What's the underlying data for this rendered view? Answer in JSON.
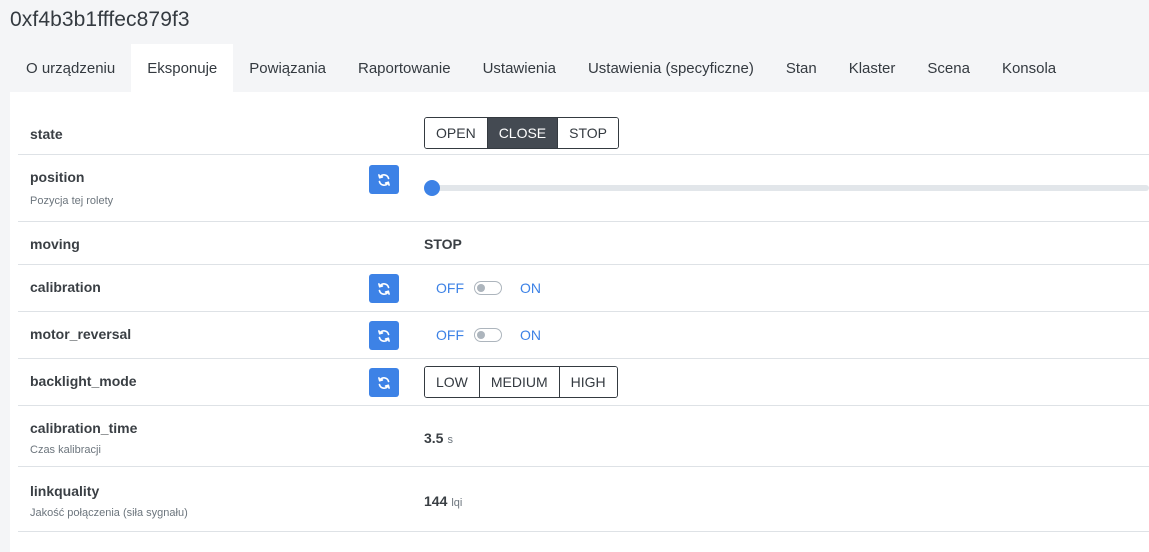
{
  "device": {
    "title": "0xf4b3b1fffec879f3"
  },
  "tabs": [
    {
      "label": "O urządzeniu",
      "active": false
    },
    {
      "label": "Eksponuje",
      "active": true
    },
    {
      "label": "Powiązania",
      "active": false
    },
    {
      "label": "Raportowanie",
      "active": false
    },
    {
      "label": "Ustawienia",
      "active": false
    },
    {
      "label": "Ustawienia (specyficzne)",
      "active": false
    },
    {
      "label": "Stan",
      "active": false
    },
    {
      "label": "Klaster",
      "active": false
    },
    {
      "label": "Scena",
      "active": false
    },
    {
      "label": "Konsola",
      "active": false
    }
  ],
  "rows": {
    "state": {
      "label": "state",
      "options": [
        "OPEN",
        "CLOSE",
        "STOP"
      ],
      "selected": "CLOSE"
    },
    "position": {
      "label": "position",
      "description": "Pozycja tej rolety",
      "value_percent": 0,
      "refresh_icon": "refresh-icon"
    },
    "moving": {
      "label": "moving",
      "value": "STOP"
    },
    "calibration": {
      "label": "calibration",
      "off_label": "OFF",
      "on_label": "ON",
      "checked": false,
      "refresh_icon": "refresh-icon"
    },
    "motor_reversal": {
      "label": "motor_reversal",
      "off_label": "OFF",
      "on_label": "ON",
      "checked": false,
      "refresh_icon": "refresh-icon"
    },
    "backlight_mode": {
      "label": "backlight_mode",
      "options": [
        "LOW",
        "MEDIUM",
        "HIGH"
      ],
      "selected": null,
      "refresh_icon": "refresh-icon"
    },
    "calibration_time": {
      "label": "calibration_time",
      "description": "Czas kalibracji",
      "value": "3.5",
      "unit": "s"
    },
    "linkquality": {
      "label": "linkquality",
      "description": "Jakość połączenia (siła sygnału)",
      "value": "144",
      "unit": "lqi"
    }
  },
  "colors": {
    "accent": "#3d82e6",
    "selected_button": "#444a52",
    "background": "#f4f5f7",
    "panel": "#ffffff"
  }
}
